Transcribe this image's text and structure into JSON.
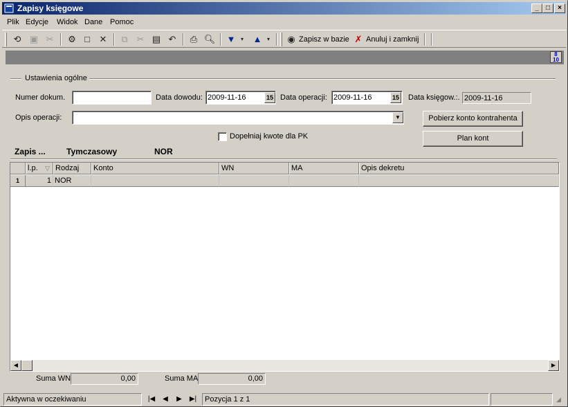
{
  "window": {
    "title": "Zapisy księgowe"
  },
  "menu": [
    "Plik",
    "Edycje",
    "Widok",
    "Dane",
    "Pomoc"
  ],
  "toolbar": {
    "save_db_label": "Zapisz w bazie",
    "cancel_close_label": "Anuluj i zamknij"
  },
  "group": {
    "title": "Ustawienia ogólne"
  },
  "form": {
    "doc_number_label": "Numer dokum.",
    "doc_number_value": "",
    "doc_date_label": "Data dowodu:",
    "doc_date_value": "2009-11-16",
    "op_date_label": "Data operacji:",
    "op_date_value": "2009-11-16",
    "book_date_label": "Data księgow.:.",
    "book_date_value": "2009-11-16",
    "op_desc_label": "Opis operacji:",
    "op_desc_value": "",
    "cal_icon": "15",
    "fetch_account_label": "Pobierz konto kontrahenta",
    "plan_label": "Plan kont",
    "fill_pk_label": "Dopełniaj kwote dla PK"
  },
  "entry": {
    "label": "Zapis ...",
    "status": "Tymczasowy",
    "type": "NOR"
  },
  "grid": {
    "columns": [
      "l.p.",
      "Rodzaj",
      "Konto",
      "WN",
      "MA",
      "Opis dekretu"
    ],
    "rows": [
      {
        "indicator": "1",
        "lp": "1",
        "rodzaj": "NOR",
        "konto": "",
        "wn": "",
        "ma": "",
        "opis": ""
      }
    ]
  },
  "sums": {
    "wn_label": "Suma WN",
    "wn_value": "0,00",
    "ma_label": "Suma MA",
    "ma_value": "0,00"
  },
  "status": {
    "state": "Aktywna w oczekiwaniu",
    "position": "Pozycja 1 z 1"
  },
  "strip_icon": {
    "top": "8",
    "bottom": "10"
  }
}
